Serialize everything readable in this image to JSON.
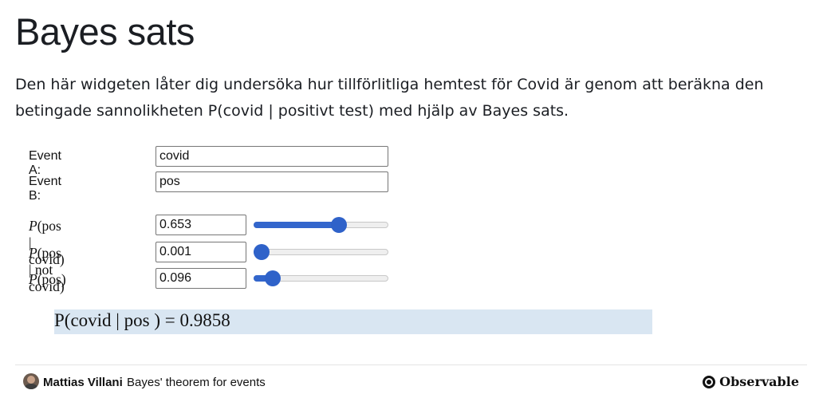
{
  "page": {
    "title": "Bayes sats",
    "intro": "Den här widgeten låter dig undersöka hur tillförlitliga hemtest för Covid är genom att beräkna den betingade sannolikheten P(covid | positivt test) med hjälp av Bayes sats."
  },
  "events": {
    "a_label": "Event A:",
    "a_value": "covid",
    "b_label": "Event B:",
    "b_value": "pos"
  },
  "probs": [
    {
      "label_var": "P",
      "label_arg": "(pos | covid)",
      "value": "0.653",
      "level": 0.653
    },
    {
      "label_var": "P",
      "label_arg": "(pos | not covid)",
      "value": "0.001",
      "level": 0.001
    },
    {
      "label_var": "P",
      "label_arg": "(pos)",
      "value": "0.096",
      "level": 0.096
    }
  ],
  "result": {
    "text": "P(covid | pos ) = 0.9858"
  },
  "footer": {
    "author": "Mattias Villani",
    "notebook_title": "Bayes' theorem for events",
    "brand": "Observable"
  },
  "colors": {
    "accent": "#3366cc",
    "result_bg": "#d9e6f2"
  }
}
